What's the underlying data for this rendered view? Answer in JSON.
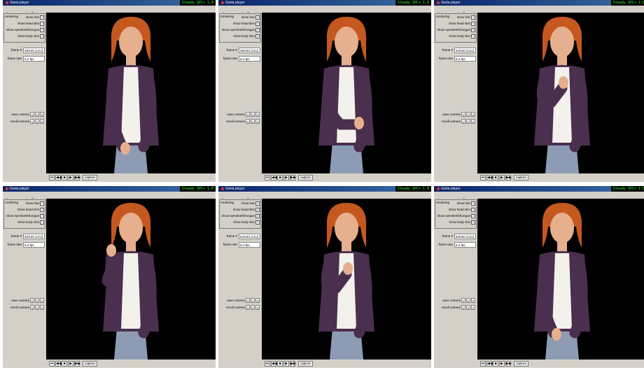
{
  "colors": {
    "titlebar": "#0a246a",
    "status_text": "#33ff33",
    "hair": "#c4581e",
    "jacket": "#4b2f4f",
    "shirt": "#f3f1ec",
    "skin": "#e6b08f",
    "jeans": "#8e9bb4"
  },
  "windows": [
    {
      "title": "Greta player",
      "status": "Steady SPC+ 1.0",
      "menu": [
        "player",
        "agent",
        "?"
      ],
      "render_label": "rendering",
      "toggles": [
        "show hair",
        "show head skin",
        "show eyes/teeth/tongue",
        "show body skin"
      ],
      "frame_label": "frame #",
      "frame_value": "28/100 (14U)",
      "rate_label": "frame rate",
      "rate_value": "6.2 fps",
      "cam1": "save camera",
      "cam2": "recall camera",
      "cam_buttons": [
        "1",
        "2",
        "3"
      ],
      "capture": "capture",
      "pose": "rest"
    },
    {
      "title": "Greta player",
      "status": "Steady SPC+ 1.0",
      "menu": [
        "player",
        "agent",
        "?"
      ],
      "render_label": "rendering",
      "toggles": [
        "show hair",
        "show head skin",
        "show eyes/teeth/tongue",
        "show body skin"
      ],
      "frame_label": "frame #",
      "frame_value": "38/100 (14U)",
      "rate_label": "frame rate",
      "rate_value": "6.4 fps",
      "cam1": "save camera",
      "cam2": "recall camera",
      "cam_buttons": [
        "1",
        "2",
        "3"
      ],
      "capture": "capture",
      "pose": "waist"
    },
    {
      "title": "Greta player",
      "status": "Steady SPC+ 1.0",
      "menu": [
        "player",
        "agent",
        "?"
      ],
      "render_label": "rendering",
      "toggles": [
        "show hair",
        "show head skin",
        "show eyes/teeth/tongue",
        "show body skin"
      ],
      "frame_label": "frame #",
      "frame_value": "44/100 (14U)",
      "rate_label": "frame rate",
      "rate_value": "6.4 fps",
      "cam1": "save camera",
      "cam2": "recall camera",
      "cam_buttons": [
        "1",
        "2",
        "3"
      ],
      "capture": "capture",
      "pose": "chest"
    },
    {
      "title": "Greta player",
      "status": "Steady SPC+ 1.0",
      "menu": [
        "player",
        "agent",
        "?"
      ],
      "render_label": "rendering",
      "toggles": [
        "show hair",
        "show head skin",
        "show eyes/teeth/tongue",
        "show body skin"
      ],
      "frame_label": "frame #",
      "frame_value": "48/100 (14U)",
      "rate_label": "frame rate",
      "rate_value": "6.4 fps",
      "cam1": "save camera",
      "cam2": "recall camera",
      "cam_buttons": [
        "1",
        "2",
        "3"
      ],
      "capture": "capture",
      "pose": "raised"
    },
    {
      "title": "Greta player",
      "status": "Steady SPC+ 1.0",
      "menu": [
        "player",
        "agent",
        "?"
      ],
      "render_label": "rendering",
      "toggles": [
        "show hair",
        "show head skin",
        "show eyes/teeth/tongue",
        "show body skin"
      ],
      "frame_label": "frame #",
      "frame_value": "54/100 (14U)",
      "rate_label": "frame rate",
      "rate_value": "6.4 fps",
      "cam1": "save camera",
      "cam2": "recall camera",
      "cam_buttons": [
        "1",
        "2",
        "3"
      ],
      "capture": "capture",
      "pose": "chest"
    },
    {
      "title": "Greta player",
      "status": "Steady SPC+ 1.0",
      "menu": [
        "player",
        "agent",
        "?"
      ],
      "render_label": "rendering",
      "toggles": [
        "show hair",
        "show head skin",
        "show eyes/teeth/tongue",
        "show body skin"
      ],
      "frame_label": "frame #",
      "frame_value": "54/100 (14U)",
      "rate_label": "frame rate",
      "rate_value": "6.4 fps",
      "cam1": "save camera",
      "cam2": "recall camera",
      "cam_buttons": [
        "1",
        "2",
        "3"
      ],
      "capture": "capture",
      "pose": "rest"
    }
  ]
}
